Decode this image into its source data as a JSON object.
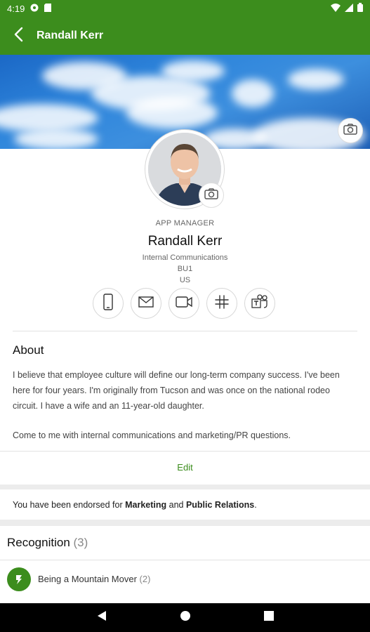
{
  "status_bar": {
    "time": "4:19",
    "icons": [
      "lastpass-icon",
      "sd-card-icon",
      "wifi-icon",
      "signal-icon",
      "battery-icon"
    ]
  },
  "app_bar": {
    "title": "Randall Kerr",
    "back_icon": "back-arrow-icon"
  },
  "colors": {
    "primary": "#3c8d1d",
    "link": "#3c8d1d",
    "background": "#ececec"
  },
  "profile": {
    "role": "APP MANAGER",
    "name": "Randall Kerr",
    "department": "Internal Communications",
    "business_unit": "BU1",
    "country": "US",
    "contact_actions": [
      "phone-icon",
      "mail-icon",
      "video-icon",
      "slack-icon",
      "teams-icon"
    ]
  },
  "about": {
    "heading": "About",
    "paragraph1_line1": "I believe that employee culture will define our long-term company success. I've been",
    "paragraph1_line2": "here for four years. I'm originally from Tucson and was once on the national rodeo",
    "paragraph1_line3": "circuit. I have a wife and an 11-year-old daughter.",
    "paragraph2": "Come to me with internal communications and marketing/PR questions.",
    "edit_label": "Edit"
  },
  "endorsement": {
    "prefix": "You have been endorsed for ",
    "skill1": "Marketing",
    "joiner": " and ",
    "skill2": "Public Relations",
    "suffix": "."
  },
  "recognition": {
    "heading": "Recognition",
    "count": "(3)",
    "items": [
      {
        "label": "Being a Mountain Mover",
        "count": "(2)",
        "icon": "mountain-mover-badge-icon"
      }
    ]
  },
  "nav_bar": {
    "buttons": [
      "back-triangle-icon",
      "home-circle-icon",
      "recents-square-icon"
    ]
  }
}
